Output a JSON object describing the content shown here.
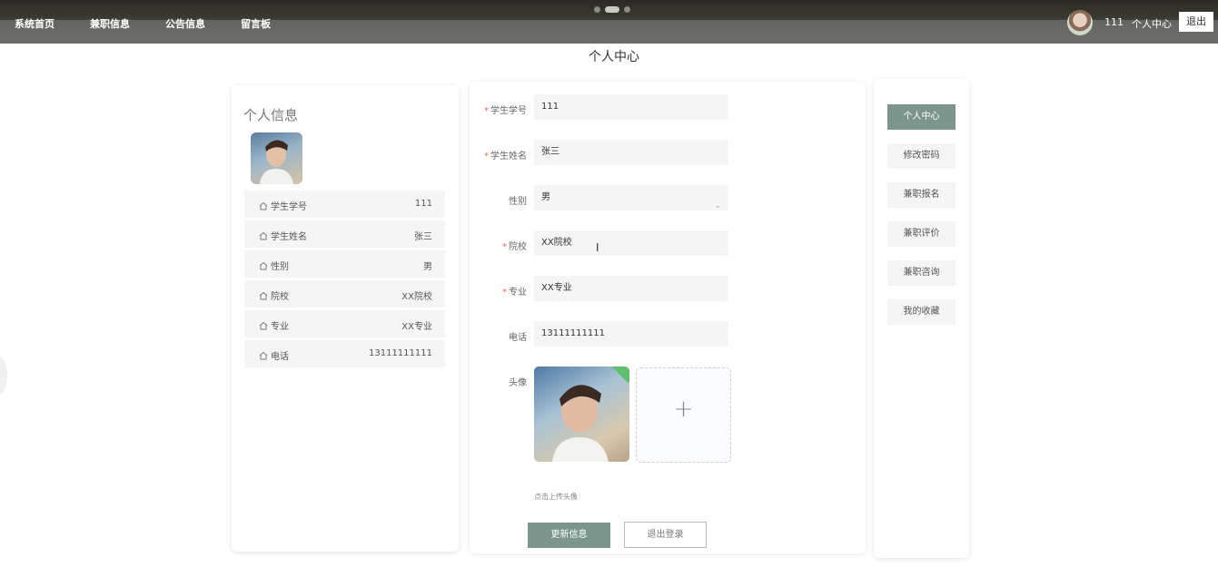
{
  "nav": {
    "items": [
      "系统首页",
      "兼职信息",
      "公告信息",
      "留言板"
    ],
    "username": "111",
    "center_link": "个人中心",
    "logout": "退出"
  },
  "page_title": "个人中心",
  "left_card": {
    "title": "个人信息",
    "rows": [
      {
        "label": "学生学号",
        "value": "111"
      },
      {
        "label": "学生姓名",
        "value": "张三"
      },
      {
        "label": "性别",
        "value": "男"
      },
      {
        "label": "院校",
        "value": "XX院校"
      },
      {
        "label": "专业",
        "value": "XX专业"
      },
      {
        "label": "电话",
        "value": "13111111111"
      }
    ]
  },
  "form": {
    "fields": [
      {
        "label": "学生学号",
        "required": "*",
        "value": "111"
      },
      {
        "label": "学生姓名",
        "required": "*",
        "value": "张三"
      },
      {
        "label": "性别",
        "required": "",
        "value": "男"
      },
      {
        "label": "院校",
        "required": "*",
        "value": "XX院校"
      },
      {
        "label": "专业",
        "required": "*",
        "value": "XX专业"
      },
      {
        "label": "电话",
        "required": "",
        "value": "13111111111"
      }
    ],
    "avatar_label": "头像",
    "upload_hint": "点击上传头像",
    "update_button": "更新信息",
    "logout_button": "退出登录"
  },
  "menu": {
    "items": [
      "个人中心",
      "修改密码",
      "兼职报名",
      "兼职评价",
      "兼职咨询",
      "我的收藏"
    ],
    "active": "个人中心"
  },
  "colors": {
    "accent": "#7c958d",
    "required": "#e96b5a",
    "upload_ok": "#5fbf6e"
  }
}
